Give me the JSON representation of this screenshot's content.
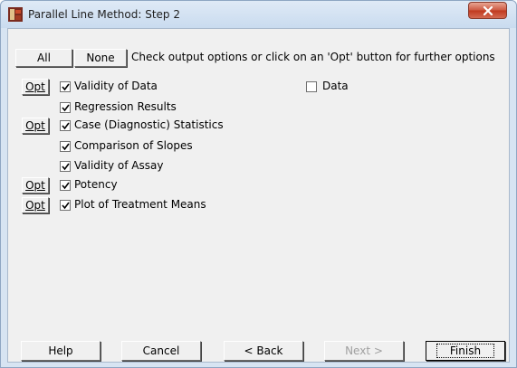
{
  "window": {
    "title": "Parallel Line Method: Step 2",
    "accent": "#cd5a43"
  },
  "toolbar": {
    "all_label": "All",
    "none_label": "None",
    "hint": "Check output options or click on an 'Opt' button for further options"
  },
  "options": [
    {
      "label": "Validity of Data",
      "checked": true,
      "has_opt": true
    },
    {
      "label": "Regression Results",
      "checked": true,
      "has_opt": false
    },
    {
      "label": "Case (Diagnostic) Statistics",
      "checked": true,
      "has_opt": true
    },
    {
      "label": "Comparison of Slopes",
      "checked": true,
      "has_opt": false
    },
    {
      "label": "Validity of Assay",
      "checked": true,
      "has_opt": false
    },
    {
      "label": "Potency",
      "checked": true,
      "has_opt": true
    },
    {
      "label": "Plot of Treatment Means",
      "checked": true,
      "has_opt": true
    }
  ],
  "data_option": {
    "label": "Data",
    "checked": false
  },
  "opt_label": "Opt",
  "footer": {
    "help": "Help",
    "cancel": "Cancel",
    "back": "< Back",
    "next": "Next >",
    "finish": "Finish"
  }
}
